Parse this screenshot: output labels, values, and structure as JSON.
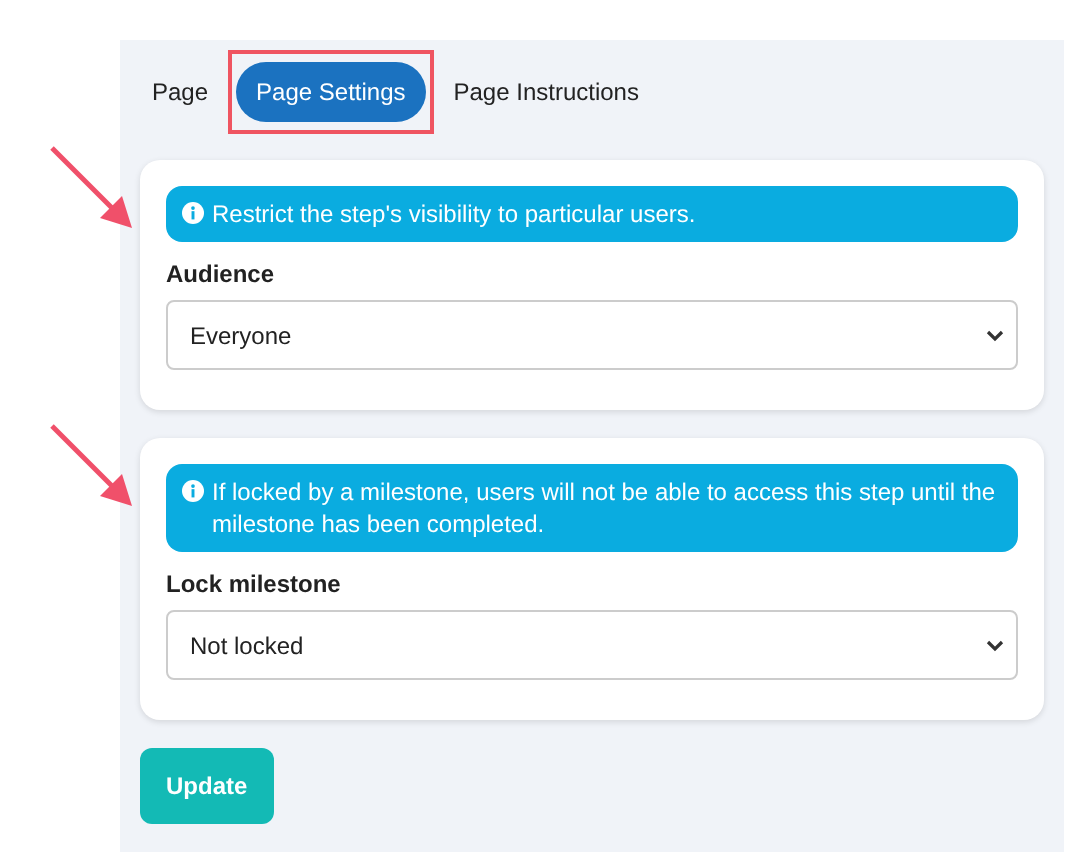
{
  "tabs": [
    {
      "label": "Page",
      "selected": false,
      "highlighted": false
    },
    {
      "label": "Page Settings",
      "selected": true,
      "highlighted": true
    },
    {
      "label": "Page Instructions",
      "selected": false,
      "highlighted": false
    }
  ],
  "sections": [
    {
      "info": "Restrict the step's visibility to particular users.",
      "label": "Audience",
      "value": "Everyone",
      "arrow": true
    },
    {
      "info": "If locked by a milestone, users will not be able to access this step until the milestone has been completed.",
      "label": "Lock milestone",
      "value": "Not locked",
      "arrow": true
    }
  ],
  "button": "Update"
}
